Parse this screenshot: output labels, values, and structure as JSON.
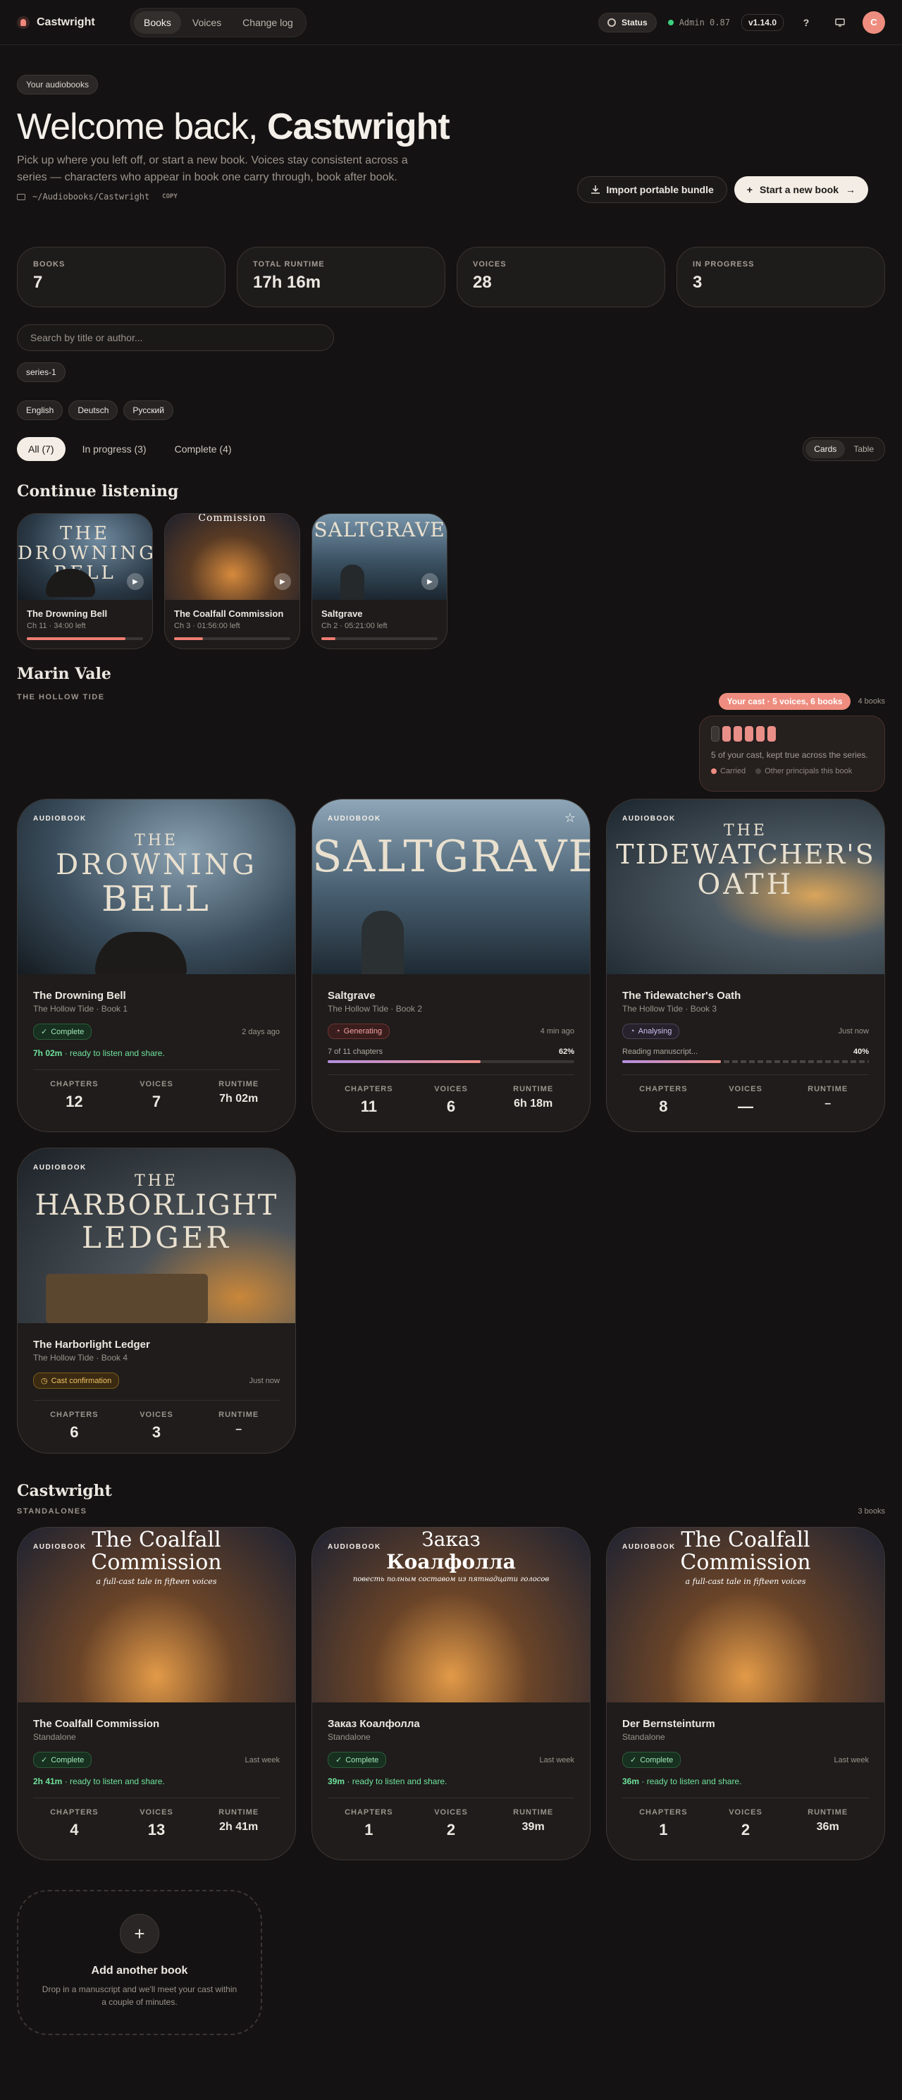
{
  "topbar": {
    "brand": "Castwright",
    "nav": [
      "Books",
      "Voices",
      "Change log"
    ],
    "status_label": "Status",
    "admin": "Admin 0.87",
    "version": "v1.14.0",
    "help": "?",
    "avatar": "C"
  },
  "hero": {
    "chip": "Your audiobooks",
    "welcome": "Welcome back,",
    "name": "Castwright",
    "subtitle": "Pick up where you left off, or start a new book. Voices stay consistent across a series — characters who appear in book one carry through, book after book.",
    "path": "~/Audiobooks/Castwright",
    "copy": "COPY",
    "import": "Import portable bundle",
    "start": "Start a new book"
  },
  "stats": [
    {
      "label": "BOOKS",
      "value": "7"
    },
    {
      "label": "TOTAL RUNTIME",
      "value": "17h 16m"
    },
    {
      "label": "VOICES",
      "value": "28"
    },
    {
      "label": "IN PROGRESS",
      "value": "3"
    }
  ],
  "search": {
    "placeholder": "Search by title or author..."
  },
  "series_tags": [
    "series-1"
  ],
  "languages": [
    "English",
    "Deutsch",
    "Русский"
  ],
  "tabs": [
    "All (7)",
    "In progress (3)",
    "Complete (4)"
  ],
  "view_toggle": [
    "Cards",
    "Table"
  ],
  "continue": {
    "heading": "Continue listening",
    "items": [
      {
        "title": "The Drowning Bell",
        "meta": "Ch 11 · 34:00 left",
        "progress": 0.85,
        "cover": "THE DROWNING BELL"
      },
      {
        "title": "The Coalfall Commission",
        "meta": "Ch 3 · 01:56:00 left",
        "progress": 0.25,
        "cover": "Commission"
      },
      {
        "title": "Saltgrave",
        "meta": "Ch 2 · 05:21:00 left",
        "progress": 0.12,
        "cover": "SALTGRAVE"
      }
    ]
  },
  "series": {
    "author": "Marin Vale",
    "name": "THE HOLLOW TIDE",
    "cast_pill": "Your cast · 5 voices, 6 books",
    "count": "4 books",
    "cast_text": "5 of your cast, kept true across the series.",
    "legend_carried": "Carried",
    "legend_other": "Other principals this book",
    "books": [
      {
        "title": "The Drowning Bell",
        "series": "The Hollow Tide · Book 1",
        "status": "Complete",
        "when": "2 days ago",
        "ready_time": "7h 02m",
        "ready_text": " · ready to listen and share.",
        "chapters": "12",
        "voices": "7",
        "runtime": "7h 02m",
        "cover": [
          "THE",
          "DROWNING",
          "BELL"
        ]
      },
      {
        "title": "Saltgrave",
        "series": "The Hollow Tide · Book 2",
        "status": "Generating",
        "when": "4 min ago",
        "prog_label": "7 of 11 chapters",
        "prog_pct": "62%",
        "progress": 0.62,
        "chapters": "11",
        "voices": "6",
        "runtime": "6h 18m",
        "cover": [
          "SALTGRAVE"
        ]
      },
      {
        "title": "The Tidewatcher's Oath",
        "series": "The Hollow Tide · Book 3",
        "status": "Analysing",
        "when": "Just now",
        "prog_label": "Reading manuscript...",
        "prog_pct": "40%",
        "progress": 0.4,
        "chapters": "8",
        "voices": "—",
        "runtime": "–",
        "cover": [
          "THE",
          "TIDEWATCHER'S",
          "OATH"
        ]
      },
      {
        "title": "The Harborlight Ledger",
        "series": "The Hollow Tide · Book 4",
        "status": "Cast confirmation",
        "when": "Just now",
        "chapters": "6",
        "voices": "3",
        "runtime": "–",
        "cover": [
          "THE",
          "HARBORLIGHT",
          "LEDGER"
        ]
      }
    ]
  },
  "standalones": {
    "author": "Castwright",
    "label": "STANDALONES",
    "count": "3 books",
    "books": [
      {
        "title": "The Coalfall Commission",
        "series": "Standalone",
        "status": "Complete",
        "when": "Last week",
        "ready_time": "2h 41m",
        "ready_text": " · ready to listen and share.",
        "chapters": "4",
        "voices": "13",
        "runtime": "2h 41m",
        "cover": [
          "The Coalfall",
          "Commission"
        ],
        "tagline": "a full-cast tale in fifteen voices"
      },
      {
        "title": "Заказ Коалфолла",
        "series": "Standalone",
        "status": "Complete",
        "when": "Last week",
        "ready_time": "39m",
        "ready_text": " · ready to listen and share.",
        "chapters": "1",
        "voices": "2",
        "runtime": "39m",
        "cover": [
          "Заказ",
          "Коалфолла"
        ],
        "tagline": "повесть полным составом из пятнадцати голосов"
      },
      {
        "title": "Der Bernsteinturm",
        "series": "Standalone",
        "status": "Complete",
        "when": "Last week",
        "ready_time": "36m",
        "ready_text": " · ready to listen and share.",
        "chapters": "1",
        "voices": "2",
        "runtime": "36m",
        "cover": [
          "The Coalfall",
          "Commission"
        ],
        "tagline": "a full-cast tale in fifteen voices"
      }
    ]
  },
  "labels": {
    "audiobook": "AUDIOBOOK",
    "chapters": "CHAPTERS",
    "voices": "VOICES",
    "runtime": "RUNTIME"
  },
  "add": {
    "title": "Add another book",
    "text": "Drop in a manuscript and we'll meet your cast within a couple of minutes.",
    "plus": "+"
  },
  "colors": {
    "accent": "#ee8d7f",
    "complete": "#6fe29c",
    "background": "#141212"
  }
}
